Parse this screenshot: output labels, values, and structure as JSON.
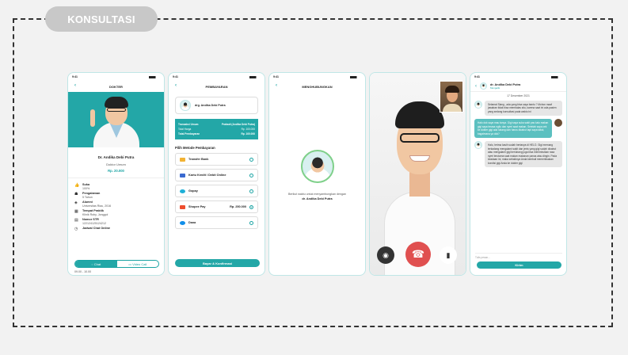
{
  "section_label": "KONSULTASI",
  "status_time": "9:41",
  "p1": {
    "title": "DOKTER",
    "name": "Dr. Andika Debi Putra",
    "spec": "Doktor Umum",
    "price": "Rp. 20.000",
    "info": [
      {
        "t": "Suka",
        "v": "100%"
      },
      {
        "t": "Pengalaman",
        "v": "5 Tahun"
      },
      {
        "t": "Alumni",
        "v": "Universitas Riau, 2016"
      },
      {
        "t": "Tempat Praktik",
        "v": "Klinik Roby, Jonggol"
      },
      {
        "t": "Nomor STR",
        "v": "122124125124212"
      },
      {
        "t": "Jadwal Chat Online",
        "v": "09.00 - 10.00"
      }
    ],
    "chat_btn": "Chat",
    "video_btn": "Video Call"
  },
  "p2": {
    "title": "PEMBAYARAN",
    "doctor": "drg. Andika Debi Putra",
    "t_umum": "Transaksi Umum",
    "t_umum_val": "Prabadi (Andika Debi Putra)",
    "total_harga": "Total Harga",
    "total_harga_val": "Rp. 100.000",
    "total_bayar": "Total Pembayaran",
    "total_bayar_val": "Rp. 100.000",
    "method_title": "Pilih Metode Pembayaran",
    "methods": [
      {
        "name": "Transfer Bank",
        "value": ""
      },
      {
        "name": "Kartu Kredit / Debit Online",
        "value": ""
      },
      {
        "name": "Gopay",
        "value": ""
      },
      {
        "name": "Shopee Pay",
        "value": "Rp. 250.000"
      },
      {
        "name": "Dana",
        "value": ""
      }
    ],
    "pay_btn": "Bayar & Konfirmasi"
  },
  "p3": {
    "title": "MENGHUBUNGKAN",
    "text": "Berikut waktu untuk menyambungkan dengan",
    "name": "dr. Andika Debi Putra"
  },
  "p5": {
    "name": "dr. Andika Debi Putra",
    "status": "Mengetik",
    "date": "17 Desember 2021",
    "msgs": [
      "Selamat Siang , ada yang bisa saya bantu ? Mohon maaf jawaban tidak bisa membalas situ, karena saat ini ada pasien yang sedang konsultasi pada waktu ini",
      "Halo dok saya mau tanya. Gigi saya suka sakit pas kalo makan gigi saya terasa ngilu dan nyeri saat makan. Setelah saya cek ke dokter gigi ada lubang dan harus dicabut tapi saya takut, bagaimana ya dok?",
      "Halo, terima kasih sudah bertanya di HELO. Gigi memang terkadang mengalami sakit dan jenis yang gigi sudah dicabut atau mengalami gigi berlubang juga bisa menimbulkan rasa nyeri terutama saat makan makanan panas atau dingin. Pada keadaan ini, maka sebaiknya Anda kembali memeriksakan kondisi gigi Anda ke dokter gigi"
    ],
    "placeholder": "Tulis pesan...",
    "send_btn": "Kirim"
  }
}
